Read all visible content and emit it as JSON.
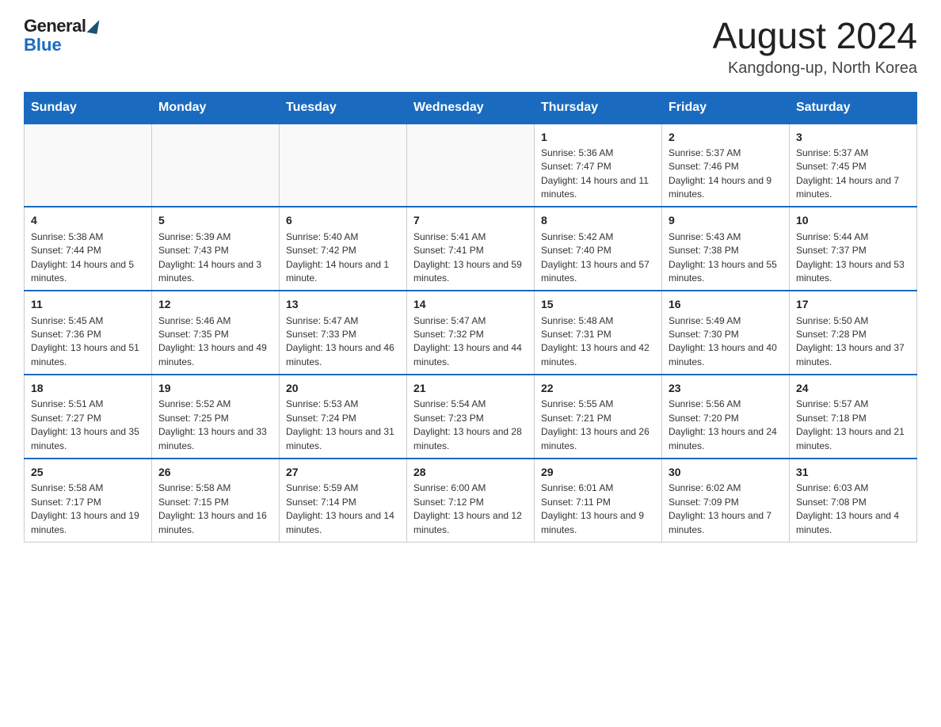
{
  "header": {
    "logo_general": "General",
    "logo_blue": "Blue",
    "month_year": "August 2024",
    "location": "Kangdong-up, North Korea"
  },
  "weekdays": [
    "Sunday",
    "Monday",
    "Tuesday",
    "Wednesday",
    "Thursday",
    "Friday",
    "Saturday"
  ],
  "weeks": [
    [
      {
        "day": "",
        "info": ""
      },
      {
        "day": "",
        "info": ""
      },
      {
        "day": "",
        "info": ""
      },
      {
        "day": "",
        "info": ""
      },
      {
        "day": "1",
        "info": "Sunrise: 5:36 AM\nSunset: 7:47 PM\nDaylight: 14 hours and 11 minutes."
      },
      {
        "day": "2",
        "info": "Sunrise: 5:37 AM\nSunset: 7:46 PM\nDaylight: 14 hours and 9 minutes."
      },
      {
        "day": "3",
        "info": "Sunrise: 5:37 AM\nSunset: 7:45 PM\nDaylight: 14 hours and 7 minutes."
      }
    ],
    [
      {
        "day": "4",
        "info": "Sunrise: 5:38 AM\nSunset: 7:44 PM\nDaylight: 14 hours and 5 minutes."
      },
      {
        "day": "5",
        "info": "Sunrise: 5:39 AM\nSunset: 7:43 PM\nDaylight: 14 hours and 3 minutes."
      },
      {
        "day": "6",
        "info": "Sunrise: 5:40 AM\nSunset: 7:42 PM\nDaylight: 14 hours and 1 minute."
      },
      {
        "day": "7",
        "info": "Sunrise: 5:41 AM\nSunset: 7:41 PM\nDaylight: 13 hours and 59 minutes."
      },
      {
        "day": "8",
        "info": "Sunrise: 5:42 AM\nSunset: 7:40 PM\nDaylight: 13 hours and 57 minutes."
      },
      {
        "day": "9",
        "info": "Sunrise: 5:43 AM\nSunset: 7:38 PM\nDaylight: 13 hours and 55 minutes."
      },
      {
        "day": "10",
        "info": "Sunrise: 5:44 AM\nSunset: 7:37 PM\nDaylight: 13 hours and 53 minutes."
      }
    ],
    [
      {
        "day": "11",
        "info": "Sunrise: 5:45 AM\nSunset: 7:36 PM\nDaylight: 13 hours and 51 minutes."
      },
      {
        "day": "12",
        "info": "Sunrise: 5:46 AM\nSunset: 7:35 PM\nDaylight: 13 hours and 49 minutes."
      },
      {
        "day": "13",
        "info": "Sunrise: 5:47 AM\nSunset: 7:33 PM\nDaylight: 13 hours and 46 minutes."
      },
      {
        "day": "14",
        "info": "Sunrise: 5:47 AM\nSunset: 7:32 PM\nDaylight: 13 hours and 44 minutes."
      },
      {
        "day": "15",
        "info": "Sunrise: 5:48 AM\nSunset: 7:31 PM\nDaylight: 13 hours and 42 minutes."
      },
      {
        "day": "16",
        "info": "Sunrise: 5:49 AM\nSunset: 7:30 PM\nDaylight: 13 hours and 40 minutes."
      },
      {
        "day": "17",
        "info": "Sunrise: 5:50 AM\nSunset: 7:28 PM\nDaylight: 13 hours and 37 minutes."
      }
    ],
    [
      {
        "day": "18",
        "info": "Sunrise: 5:51 AM\nSunset: 7:27 PM\nDaylight: 13 hours and 35 minutes."
      },
      {
        "day": "19",
        "info": "Sunrise: 5:52 AM\nSunset: 7:25 PM\nDaylight: 13 hours and 33 minutes."
      },
      {
        "day": "20",
        "info": "Sunrise: 5:53 AM\nSunset: 7:24 PM\nDaylight: 13 hours and 31 minutes."
      },
      {
        "day": "21",
        "info": "Sunrise: 5:54 AM\nSunset: 7:23 PM\nDaylight: 13 hours and 28 minutes."
      },
      {
        "day": "22",
        "info": "Sunrise: 5:55 AM\nSunset: 7:21 PM\nDaylight: 13 hours and 26 minutes."
      },
      {
        "day": "23",
        "info": "Sunrise: 5:56 AM\nSunset: 7:20 PM\nDaylight: 13 hours and 24 minutes."
      },
      {
        "day": "24",
        "info": "Sunrise: 5:57 AM\nSunset: 7:18 PM\nDaylight: 13 hours and 21 minutes."
      }
    ],
    [
      {
        "day": "25",
        "info": "Sunrise: 5:58 AM\nSunset: 7:17 PM\nDaylight: 13 hours and 19 minutes."
      },
      {
        "day": "26",
        "info": "Sunrise: 5:58 AM\nSunset: 7:15 PM\nDaylight: 13 hours and 16 minutes."
      },
      {
        "day": "27",
        "info": "Sunrise: 5:59 AM\nSunset: 7:14 PM\nDaylight: 13 hours and 14 minutes."
      },
      {
        "day": "28",
        "info": "Sunrise: 6:00 AM\nSunset: 7:12 PM\nDaylight: 13 hours and 12 minutes."
      },
      {
        "day": "29",
        "info": "Sunrise: 6:01 AM\nSunset: 7:11 PM\nDaylight: 13 hours and 9 minutes."
      },
      {
        "day": "30",
        "info": "Sunrise: 6:02 AM\nSunset: 7:09 PM\nDaylight: 13 hours and 7 minutes."
      },
      {
        "day": "31",
        "info": "Sunrise: 6:03 AM\nSunset: 7:08 PM\nDaylight: 13 hours and 4 minutes."
      }
    ]
  ]
}
